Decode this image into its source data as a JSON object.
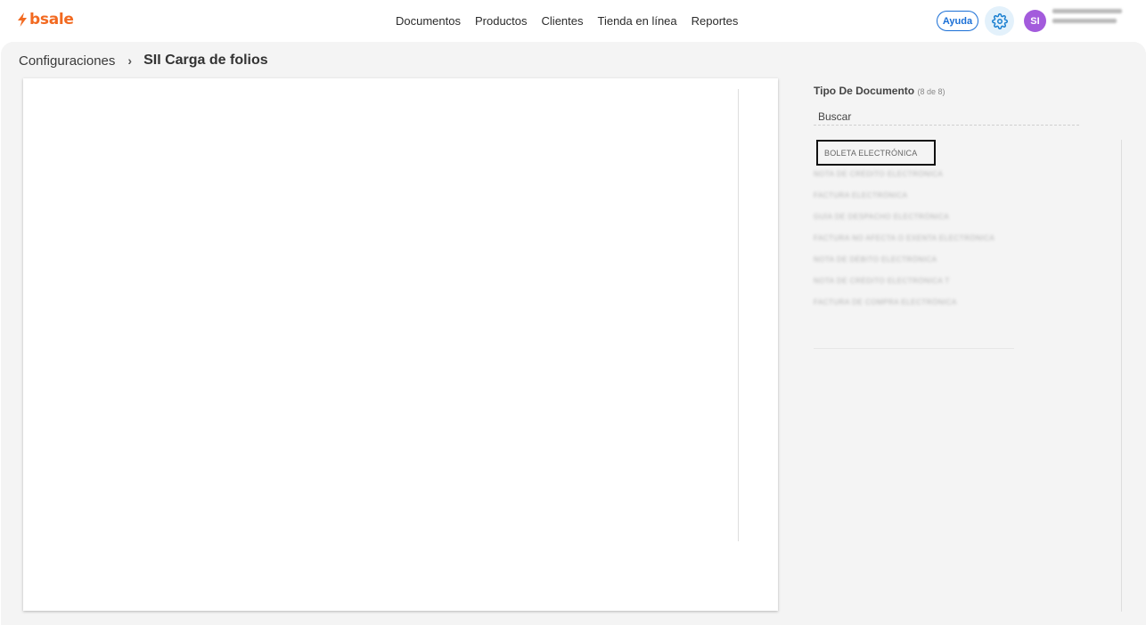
{
  "brand": {
    "logo_text": "bsale",
    "logo_color": "#f26a21"
  },
  "nav": {
    "items": [
      "Documentos",
      "Productos",
      "Clientes",
      "Tienda en línea",
      "Reportes"
    ]
  },
  "header": {
    "help_label": "Ayuda",
    "avatar_initials": "SI",
    "accent": "#1a6fd6",
    "avatar_color": "#a35bdc"
  },
  "breadcrumb": {
    "parent": "Configuraciones",
    "separator": "›",
    "current": "SII Carga de folios"
  },
  "filter": {
    "title": "Tipo De Documento",
    "count": "(8 de 8)",
    "search_placeholder": "Buscar",
    "options": [
      "BOLETA ELECTRÓNICA",
      "NOTA DE CRÉDITO ELECTRÓNICA",
      "FACTURA ELECTRÓNICA",
      "GUÍA DE DESPACHO ELECTRÓNICA",
      "FACTURA NO AFECTA O EXENTA ELECTRÓNICA",
      "NOTA DE DÉBITO ELECTRÓNICA",
      "NOTA DE CRÉDITO ELECTRÓNICA T",
      "FACTURA DE COMPRA ELECTRÓNICA"
    ]
  }
}
